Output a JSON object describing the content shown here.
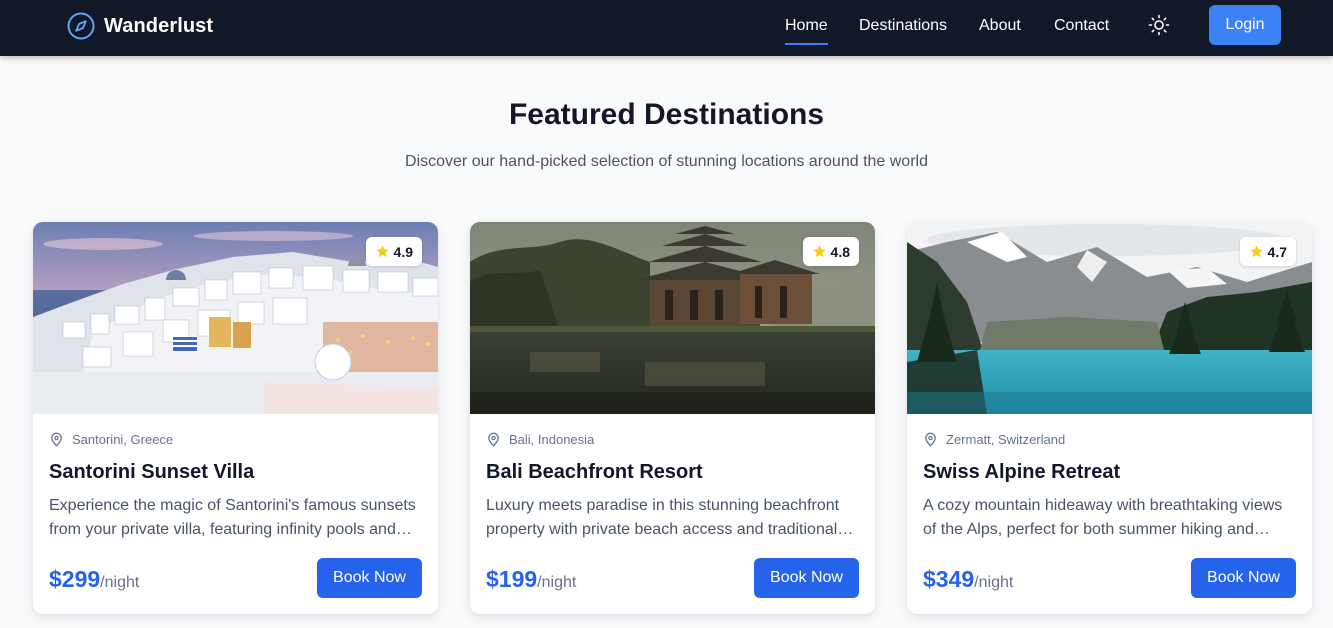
{
  "nav": {
    "brand": "Wanderlust",
    "links": [
      "Home",
      "Destinations",
      "About",
      "Contact"
    ],
    "active": "Home",
    "theme_icon": "sun-icon",
    "login_label": "Login",
    "accent": "#3b82f6",
    "background": "#111827"
  },
  "header": {
    "title": "Featured Destinations",
    "subtitle": "Discover our hand-picked selection of stunning locations around the world"
  },
  "cards": [
    {
      "rating": "4.9",
      "location": "Santorini, Greece",
      "title": "Santorini Sunset Villa",
      "description": "Experience the magic of Santorini's famous sunsets from your private villa, featuring infinity pools and panoramic views of the caldera.",
      "price": "$299",
      "unit": "/night",
      "button": "Book Now"
    },
    {
      "rating": "4.8",
      "location": "Bali, Indonesia",
      "title": "Bali Beachfront Resort",
      "description": "Luxury meets paradise in this stunning beachfront property with private beach access and traditional Balinese architecture.",
      "price": "$199",
      "unit": "/night",
      "button": "Book Now"
    },
    {
      "rating": "4.7",
      "location": "Zermatt, Switzerland",
      "title": "Swiss Alpine Retreat",
      "description": "A cozy mountain hideaway with breathtaking views of the Alps, perfect for both summer hiking and winter skiing adventures.",
      "price": "$349",
      "unit": "/night",
      "button": "Book Now"
    }
  ],
  "colors": {
    "primary": "#2563eb",
    "star": "#facc15",
    "page_background": "#f8fafc"
  }
}
